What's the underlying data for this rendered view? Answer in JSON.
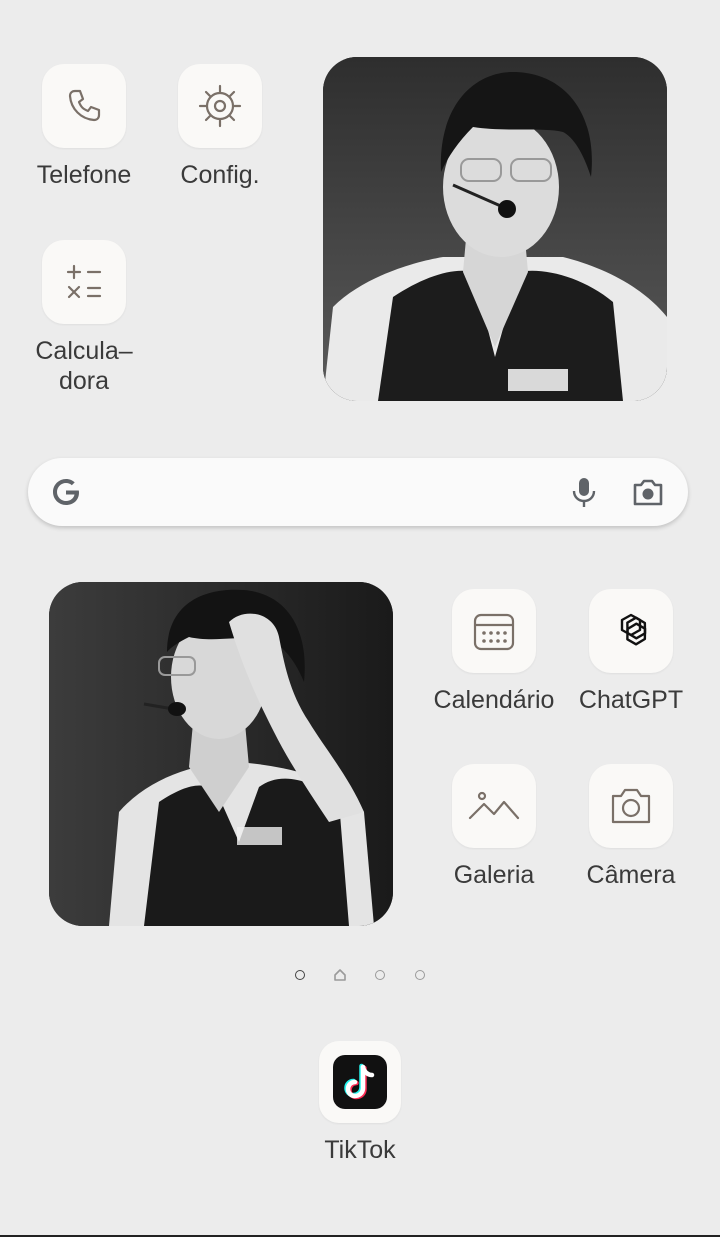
{
  "apps": {
    "telefone": {
      "label": "Telefone",
      "icon": "phone-icon"
    },
    "config": {
      "label": "Config.",
      "icon": "gear-icon"
    },
    "calculadora": {
      "label": "Calcula–\ndora",
      "icon": "calculator-icon"
    },
    "calendario": {
      "label": "Calendário",
      "icon": "calendar-icon"
    },
    "chatgpt": {
      "label": "ChatGPT",
      "icon": "chatgpt-icon"
    },
    "galeria": {
      "label": "Galeria",
      "icon": "gallery-icon"
    },
    "camera": {
      "label": "Câmera",
      "icon": "camera-icon"
    },
    "tiktok": {
      "label": "TikTok",
      "icon": "tiktok-icon"
    }
  },
  "search_widget": {
    "logo": "google-icon",
    "mic": "microphone-icon",
    "lens": "camera-lens-icon"
  },
  "page_indicator": {
    "pages": 4,
    "current_page": 1
  },
  "colors": {
    "background": "#ececec",
    "tile": "#faf9f7",
    "icon_stroke": "#7a7068",
    "label": "#3a3a3a"
  }
}
